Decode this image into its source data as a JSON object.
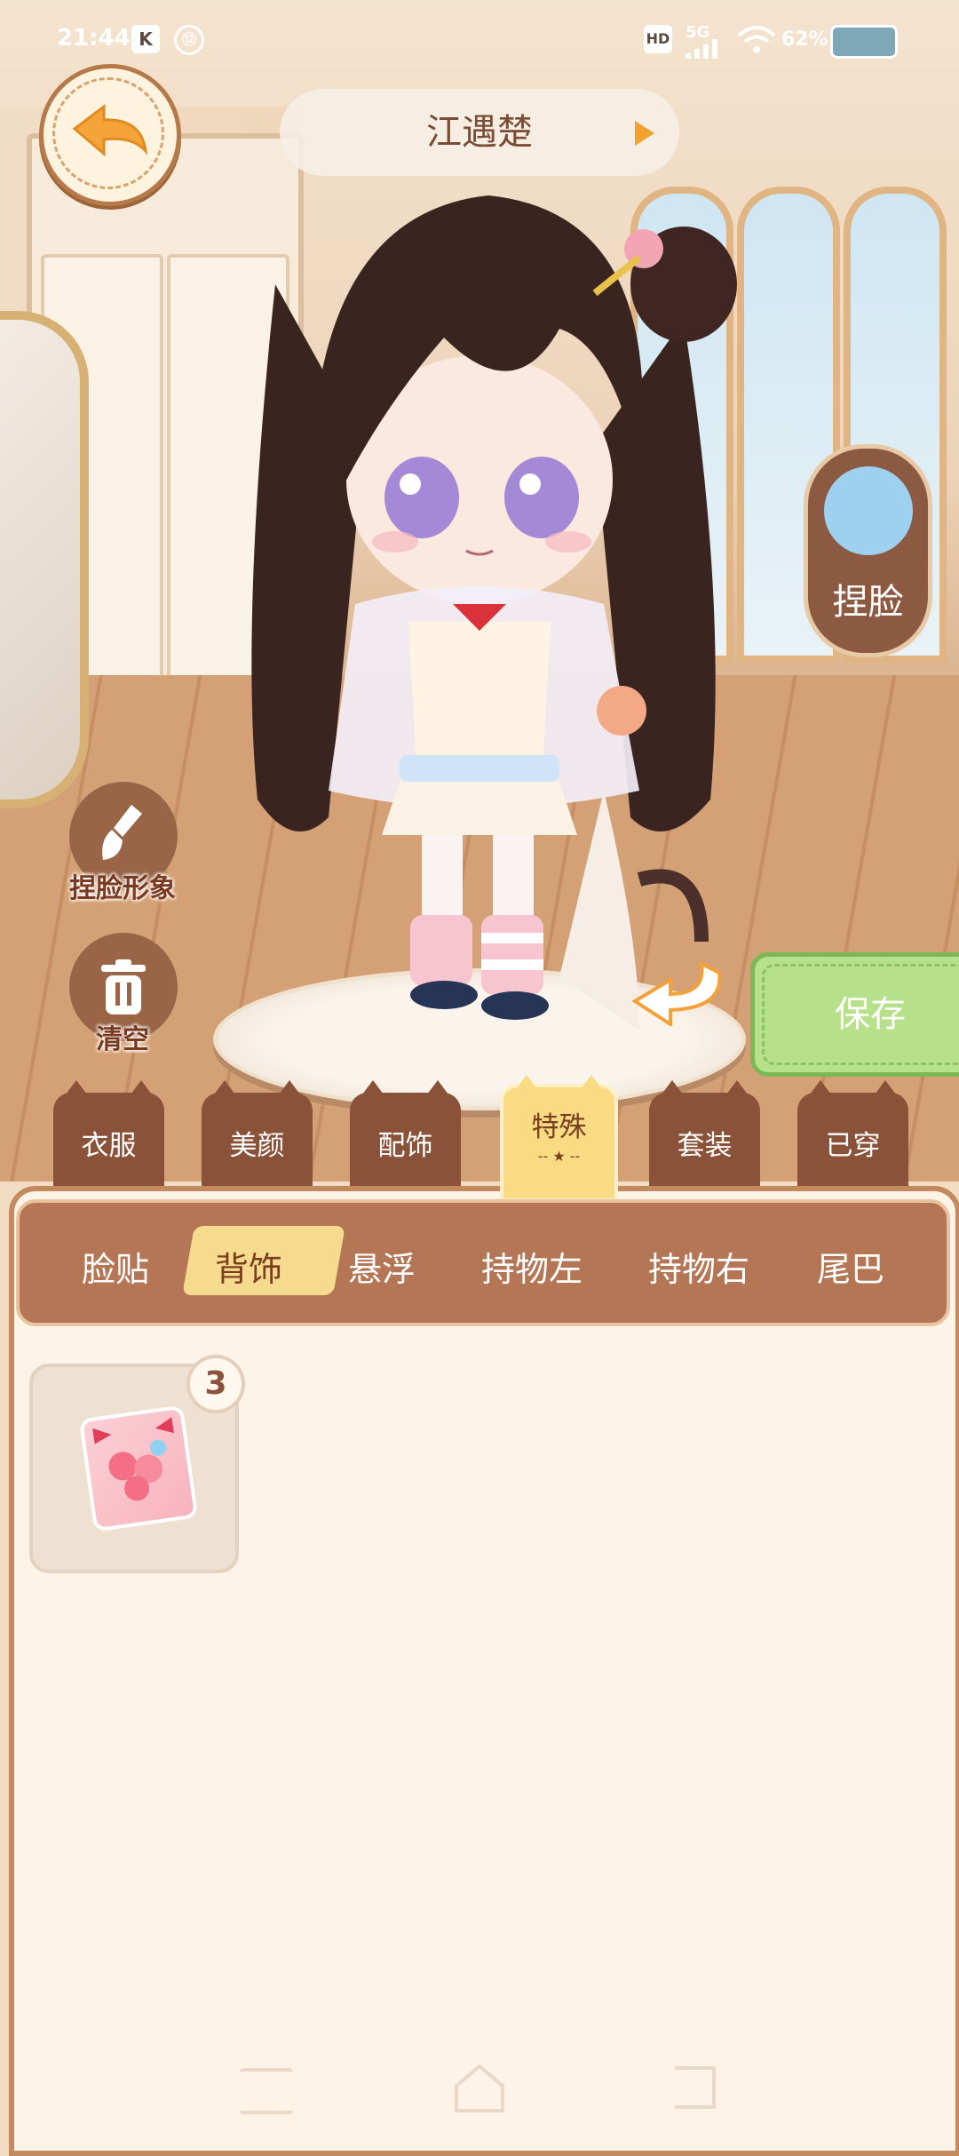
{
  "status_bar": {
    "time": "21:44",
    "app_badges": [
      "K",
      "⑫"
    ],
    "hd": "HD",
    "network": "5G",
    "battery_percent": "62%"
  },
  "header": {
    "character_name": "江遇楚"
  },
  "side_controls": {
    "face_edit_label": "捏脸",
    "face_image_label": "捏脸形象",
    "clear_label": "清空",
    "save_label": "保存"
  },
  "category_tabs": [
    {
      "label": "衣服",
      "active": false
    },
    {
      "label": "美颜",
      "active": false
    },
    {
      "label": "配饰",
      "active": false
    },
    {
      "label": "特殊",
      "active": true
    },
    {
      "label": "套装",
      "active": false
    },
    {
      "label": "已穿",
      "active": false
    }
  ],
  "sub_tabs": [
    {
      "label": "脸贴",
      "active": false
    },
    {
      "label": "背饰",
      "active": true
    },
    {
      "label": "悬浮",
      "active": false
    },
    {
      "label": "持物左",
      "active": false
    },
    {
      "label": "持物右",
      "active": false
    },
    {
      "label": "尾巴",
      "active": false
    }
  ],
  "items": [
    {
      "name": "strawberry-candy-bag",
      "count": "3"
    }
  ],
  "colors": {
    "panel_bg": "#fdf3e6",
    "tab_brown": "#8a5238",
    "active_yellow": "#f8db83",
    "save_green": "#b7e08a"
  }
}
